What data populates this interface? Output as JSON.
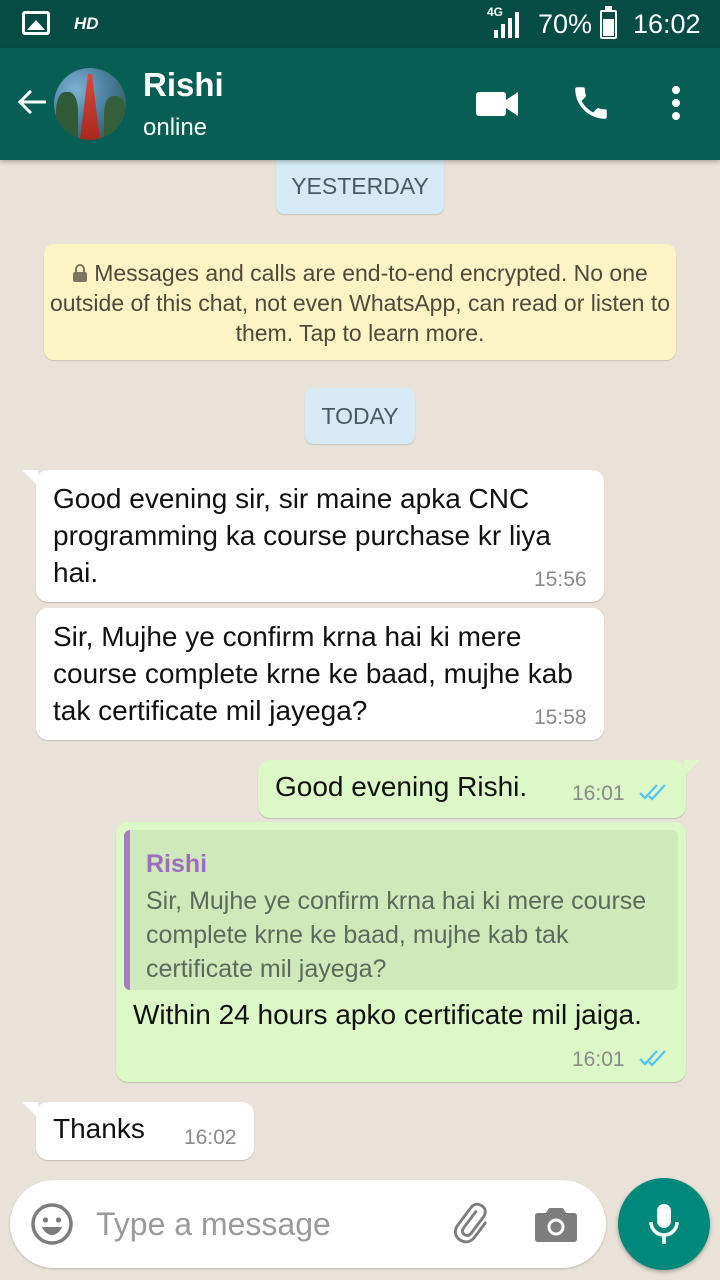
{
  "status_bar": {
    "hd_label": "HD",
    "network": "4G",
    "battery_percent": "70%",
    "battery_level": 0.7,
    "time": "16:02"
  },
  "header": {
    "contact_name": "Rishi",
    "contact_status": "online",
    "icons": [
      "back-arrow-icon",
      "video-call-icon",
      "phone-icon",
      "more-vert-icon"
    ]
  },
  "chat": {
    "date_yesterday": "YESTERDAY",
    "encryption_notice": "Messages and calls are end-to-end encrypted. No one outside of this chat, not even WhatsApp, can read or listen to them. Tap to learn more.",
    "date_today": "TODAY",
    "messages": [
      {
        "direction": "incoming",
        "text": "Good evening sir, sir maine apka CNC programming ka course purchase kr liya hai.",
        "time": "15:56"
      },
      {
        "direction": "incoming",
        "text": "Sir, Mujhe ye confirm krna hai ki mere course complete krne ke baad, mujhe kab tak certificate mil jayega?",
        "time": "15:58"
      },
      {
        "direction": "outgoing",
        "text": "Good evening Rishi.",
        "time": "16:01",
        "read": true
      },
      {
        "direction": "outgoing",
        "quote_author": "Rishi",
        "quote_text": "Sir, Mujhe ye confirm krna hai ki mere course complete krne ke baad, mujhe kab tak certificate mil jayega?",
        "text": "Within 24 hours apko certificate mil jaiga.",
        "time": "16:01",
        "read": true
      },
      {
        "direction": "incoming",
        "text": "Thanks",
        "time": "16:02"
      }
    ]
  },
  "composer": {
    "placeholder": "Type a message",
    "value": ""
  },
  "colors": {
    "header": "#075e54",
    "status_bar": "#054d44",
    "outgoing_bubble": "#dcf8c6",
    "accent": "#00897b",
    "read_ticks": "#4fc3f7"
  }
}
